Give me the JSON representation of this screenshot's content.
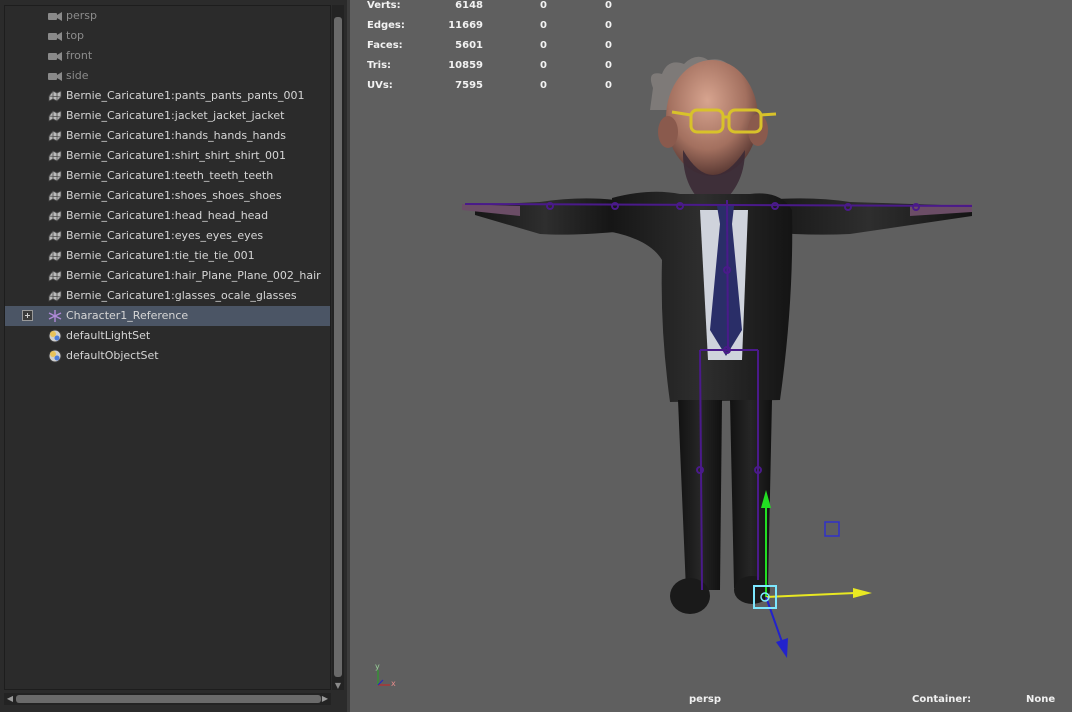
{
  "outliner": {
    "items": [
      {
        "label": "persp",
        "type": "camera"
      },
      {
        "label": "top",
        "type": "camera"
      },
      {
        "label": "front",
        "type": "camera"
      },
      {
        "label": "side",
        "type": "camera"
      },
      {
        "label": "Bernie_Caricature1:pants_pants_pants_001",
        "type": "mesh"
      },
      {
        "label": "Bernie_Caricature1:jacket_jacket_jacket",
        "type": "mesh"
      },
      {
        "label": "Bernie_Caricature1:hands_hands_hands",
        "type": "mesh"
      },
      {
        "label": "Bernie_Caricature1:shirt_shirt_shirt_001",
        "type": "mesh"
      },
      {
        "label": "Bernie_Caricature1:teeth_teeth_teeth",
        "type": "mesh"
      },
      {
        "label": "Bernie_Caricature1:shoes_shoes_shoes",
        "type": "mesh"
      },
      {
        "label": "Bernie_Caricature1:head_head_head",
        "type": "mesh"
      },
      {
        "label": "Bernie_Caricature1:eyes_eyes_eyes",
        "type": "mesh"
      },
      {
        "label": "Bernie_Caricature1:tie_tie_tie_001",
        "type": "mesh"
      },
      {
        "label": "Bernie_Caricature1:hair_Plane_Plane_002_hair",
        "type": "mesh"
      },
      {
        "label": "Bernie_Caricature1:glasses_ocale_glasses",
        "type": "mesh"
      },
      {
        "label": "Character1_Reference",
        "type": "joint",
        "selected": true
      },
      {
        "label": "defaultLightSet",
        "type": "set"
      },
      {
        "label": "defaultObjectSet",
        "type": "set"
      }
    ],
    "icon_names": {
      "camera": "camera-icon",
      "mesh": "mesh-icon",
      "joint": "joint-icon",
      "set": "set-icon"
    }
  },
  "hud": {
    "rows": [
      {
        "key": "Verts:",
        "v1": "6148",
        "v2": "0",
        "v3": "0"
      },
      {
        "key": "Edges:",
        "v1": "11669",
        "v2": "0",
        "v3": "0"
      },
      {
        "key": "Faces:",
        "v1": "5601",
        "v2": "0",
        "v3": "0"
      },
      {
        "key": "Tris:",
        "v1": "10859",
        "v2": "0",
        "v3": "0"
      },
      {
        "key": "UVs:",
        "v1": "7595",
        "v2": "0",
        "v3": "0"
      }
    ]
  },
  "viewport": {
    "camera": "persp",
    "container_label": "Container:",
    "container_value": "None",
    "axis_labels": {
      "y": "y",
      "x": "x"
    }
  },
  "colors": {
    "selection": "#4b5565",
    "viewport_bg": "#5f5f5f",
    "skeleton": "#4a1a8a",
    "manip_y": "#22dd22",
    "manip_x": "#e8e822",
    "manip_z": "#2222cc"
  }
}
